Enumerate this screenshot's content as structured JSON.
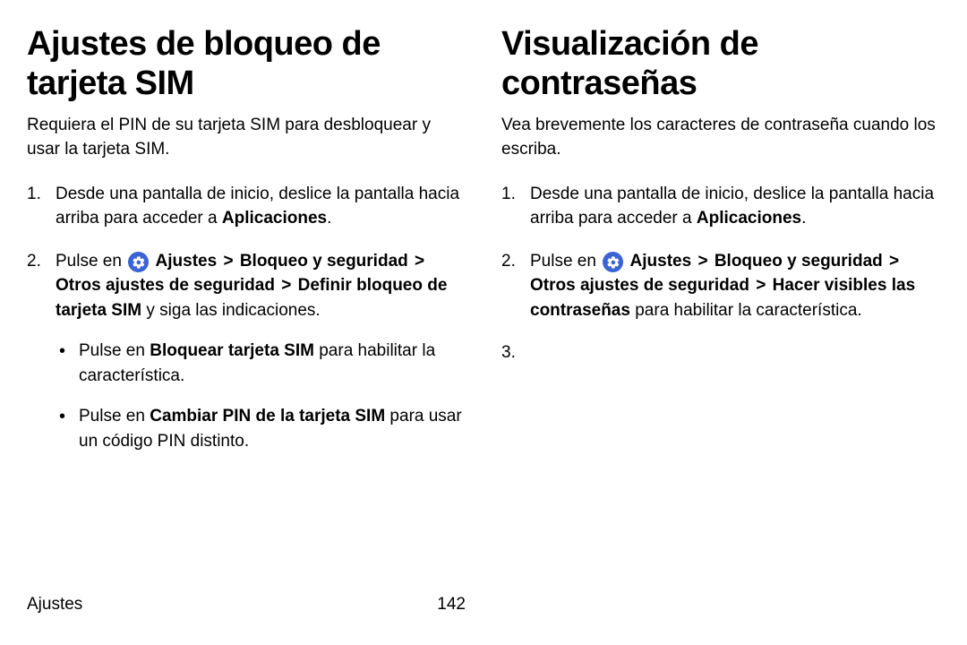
{
  "left": {
    "title": "Ajustes de bloqueo de tarjeta SIM",
    "intro": "Requiera el PIN de su tarjeta SIM para desbloquear y usar la tarjeta SIM.",
    "step1_a": "Desde una pantalla de inicio, deslice la pantalla hacia arriba para acceder a ",
    "step1_b": "Aplicaciones",
    "step1_c": ".",
    "step2_a": "Pulse en ",
    "step2_b": "Ajustes",
    "step2_c": "Bloqueo y seguridad",
    "step2_d": "Otros ajustes de seguridad",
    "step2_e": "Definir bloqueo de tarjeta SIM",
    "step2_f": " y siga las indicaciones.",
    "sub1_a": "Pulse en ",
    "sub1_b": "Bloquear tarjeta SIM",
    "sub1_c": " para habilitar la característica.",
    "sub2_a": "Pulse en ",
    "sub2_b": "Cambiar PIN de la tarjeta SIM",
    "sub2_c": " para usar un código PIN distinto."
  },
  "right": {
    "title": "Visualización de contraseñas",
    "intro": "Vea brevemente los caracteres de contraseña cuando los escriba.",
    "step1_a": "Desde una pantalla de inicio, deslice la pantalla hacia arriba para acceder a ",
    "step1_b": "Aplicaciones",
    "step1_c": ".",
    "step2_a": "Pulse en ",
    "step2_b": "Ajustes",
    "step2_c": "Bloqueo y seguridad",
    "step2_d": "Otros ajustes de seguridad",
    "step2_e": "Hacer visibles las contraseñas",
    "step2_f": " para habilitar la característica.",
    "step3": ""
  },
  "footer": {
    "section": "Ajustes",
    "page": "142"
  },
  "glyph": {
    "gt": ">"
  }
}
